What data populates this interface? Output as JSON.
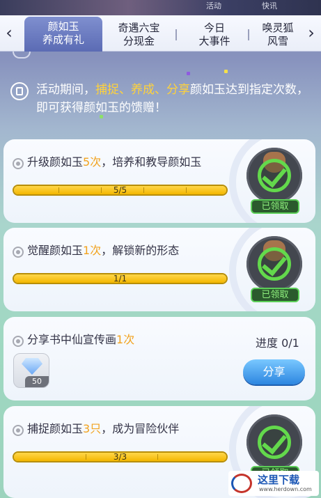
{
  "top_strip": {
    "ghost_left": "活动",
    "ghost_right": "快讯"
  },
  "tabs": [
    {
      "line1": "颜如玉",
      "line2": "养成有礼",
      "active": true
    },
    {
      "line1": "奇遇六宝",
      "line2": "分现金",
      "active": false
    },
    {
      "line1": "今日",
      "line2": "大事件",
      "active": false
    },
    {
      "line1": "唤灵狐",
      "line2": "风雪",
      "active": false
    }
  ],
  "notice": {
    "prefix": "活动期间，",
    "highlight": "捕捉、养成、分享",
    "suffix": "颜如玉达到指定次数，即可获得颜如玉的馈赠！"
  },
  "tasks": [
    {
      "text_before": "升级颜如玉",
      "count": "5次",
      "text_after": "，培养和教导颜如玉",
      "progress_label": "5/5",
      "progress_fraction": 1.0,
      "status": "已领取"
    },
    {
      "text_before": "觉醒颜如玉",
      "count": "1次",
      "text_after": "，解锁新的形态",
      "progress_label": "1/1",
      "progress_fraction": 1.0,
      "status": "已领取"
    },
    {
      "text_before": "分享书中仙宣传画",
      "count": "1次",
      "text_after": "",
      "progress_text": "进度 0/1",
      "reward_count": "50",
      "button": "分享"
    },
    {
      "text_before": "捕捉颜如玉",
      "count": "3只",
      "text_after": "，成为冒险伙伴",
      "progress_label": "3/3",
      "progress_fraction": 1.0,
      "status": "已领取"
    }
  ],
  "watermark": {
    "title": "这里下载",
    "url": "www.herdown.com"
  },
  "colors": {
    "accent_yellow": "#ffd23b",
    "count_orange": "#f2a21d",
    "claimed_green": "#63d94c",
    "share_blue": "#2d86e0",
    "tab_active": "#6c7cc2"
  }
}
